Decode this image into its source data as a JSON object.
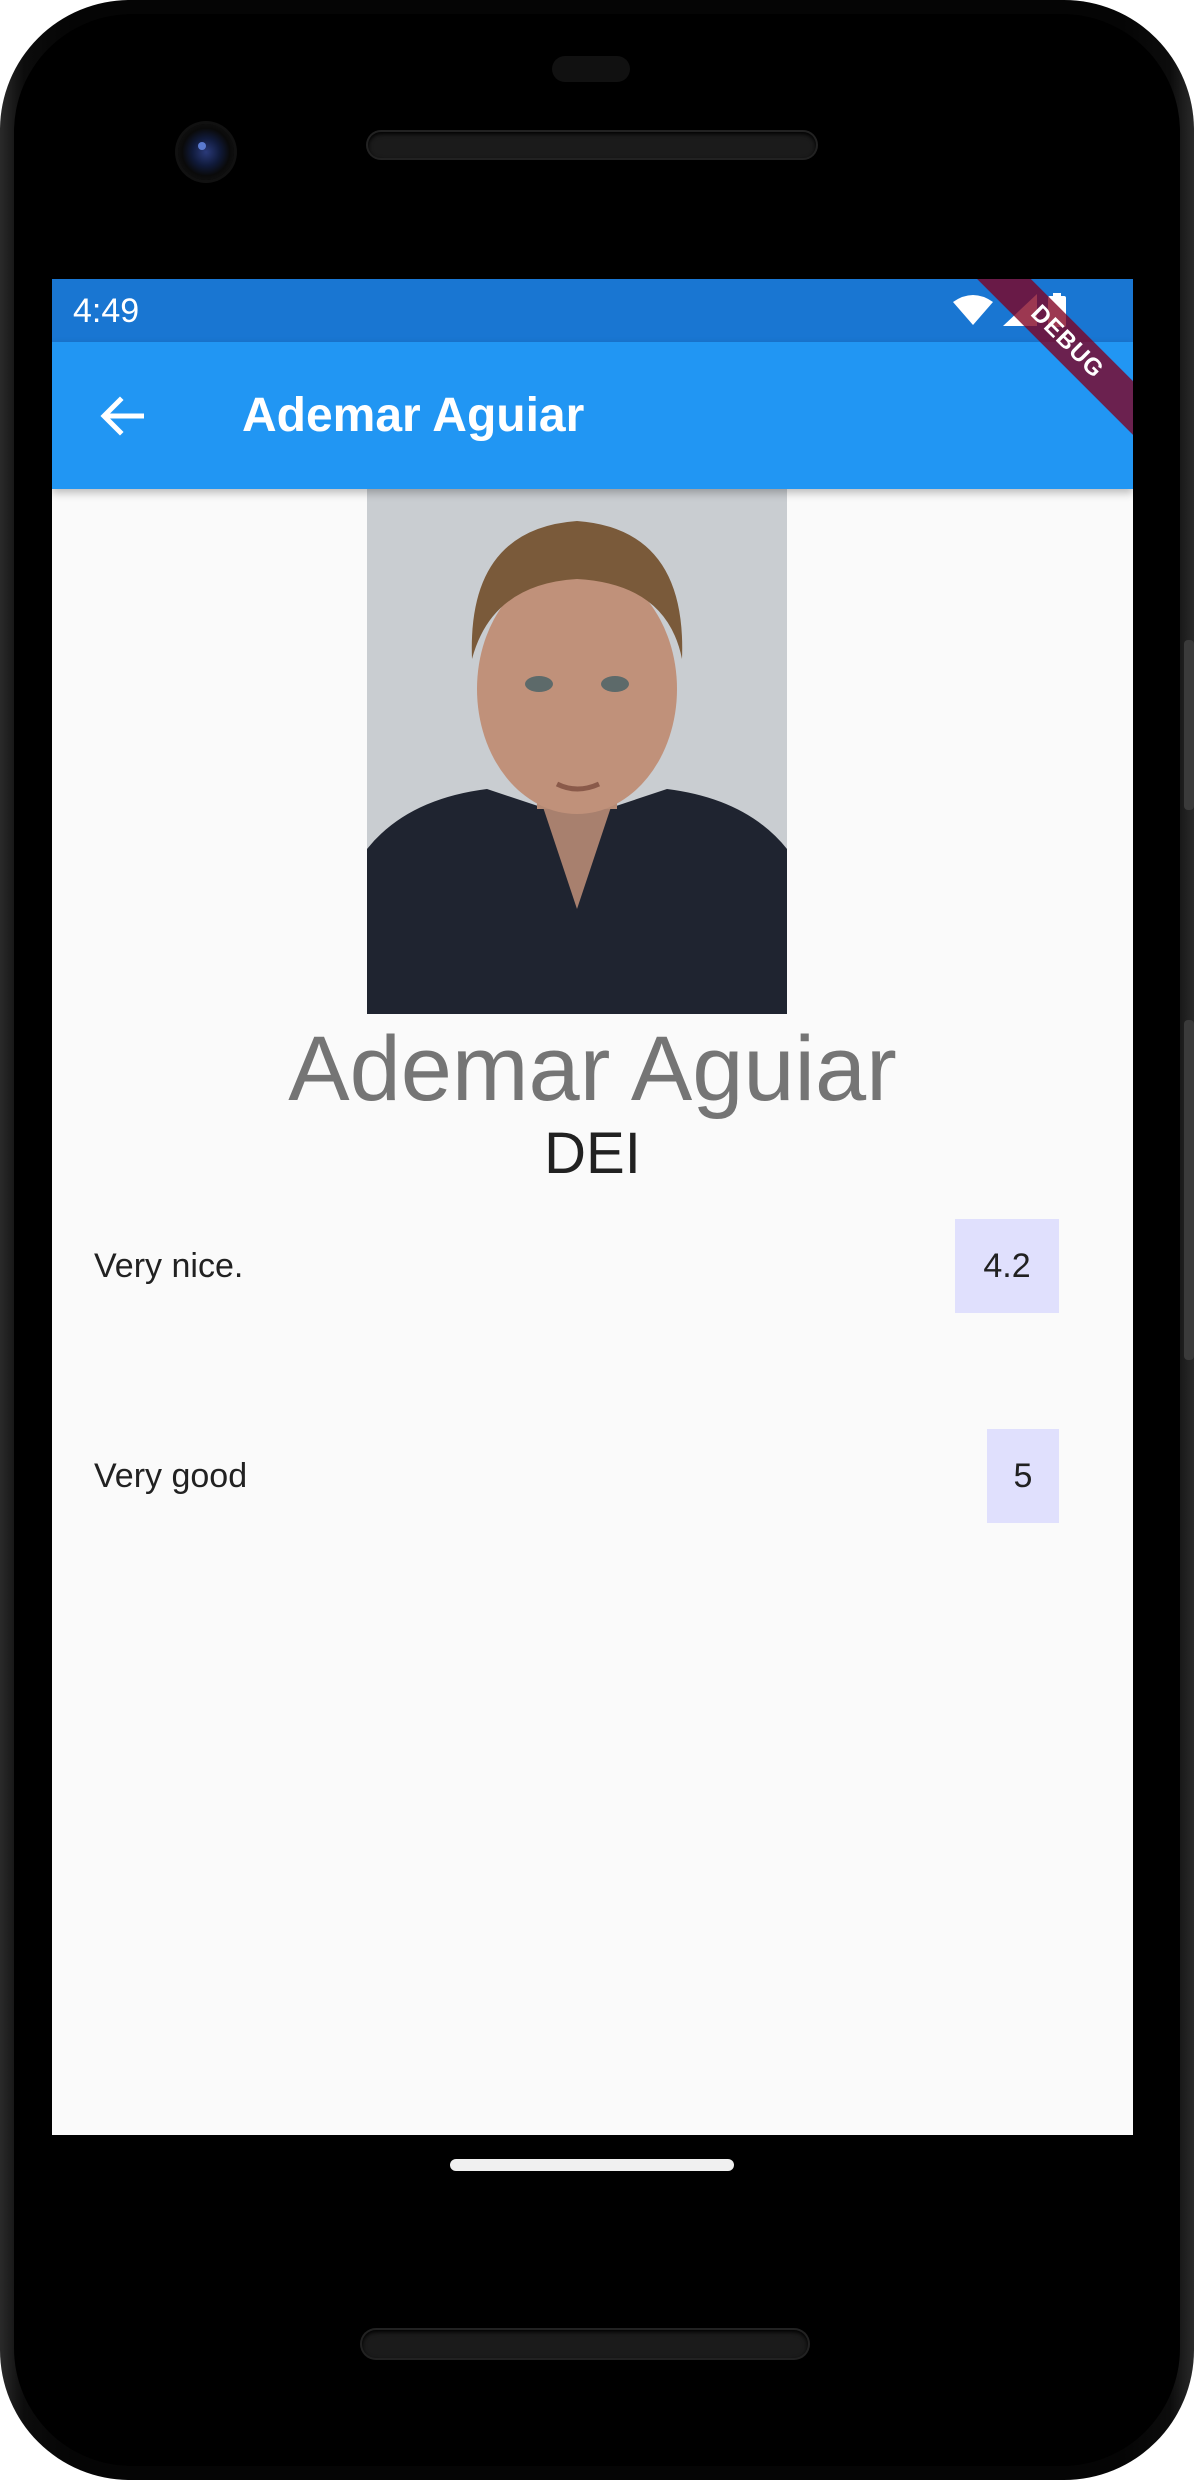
{
  "status_bar": {
    "time": "4:49",
    "icons": [
      "wifi-icon",
      "signal-icon",
      "battery-icon"
    ]
  },
  "app_bar": {
    "back_icon": "arrow-back-icon",
    "title": "Ademar Aguiar",
    "debug_banner": "DEBUG"
  },
  "profile": {
    "name": "Ademar Aguiar",
    "department": "DEI"
  },
  "reviews": [
    {
      "comment": "Very nice.",
      "score": "4.2"
    },
    {
      "comment": "Very good",
      "score": "5"
    }
  ],
  "colors": {
    "status_bar": "#1976d2",
    "app_bar": "#2196f3",
    "score_background": "#e0e0fd",
    "background": "#fafafa"
  }
}
